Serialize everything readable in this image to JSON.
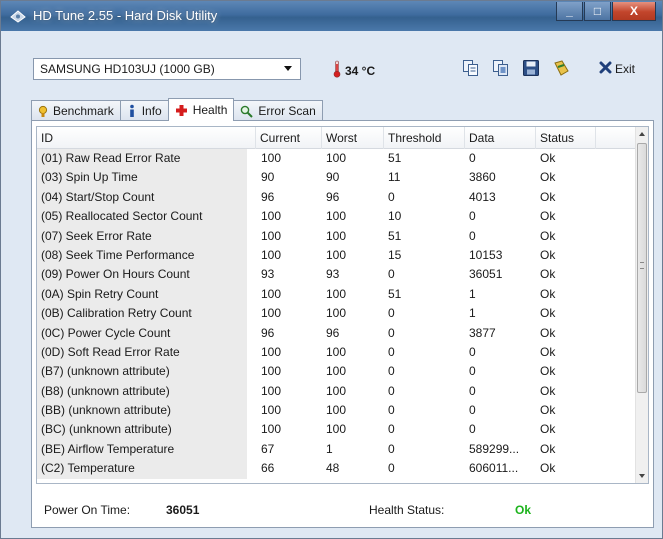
{
  "window": {
    "title": "HD Tune 2.55 - Hard Disk Utility",
    "buttons": {
      "minimize": "_",
      "maximize": "□",
      "close": "X"
    }
  },
  "toolbar": {
    "drive": "SAMSUNG HD103UJ (1000 GB)",
    "temperature": "34 °C",
    "icons": [
      "copy-text-icon",
      "copy-screenshot-icon",
      "save-icon",
      "options-icon"
    ],
    "exit_label": "Exit"
  },
  "tabs": [
    {
      "label": "Benchmark",
      "icon": "benchmark-icon"
    },
    {
      "label": "Info",
      "icon": "info-icon"
    },
    {
      "label": "Health",
      "icon": "health-icon",
      "active": true
    },
    {
      "label": "Error Scan",
      "icon": "error-scan-icon"
    }
  ],
  "health_table": {
    "columns": [
      "ID",
      "Current",
      "Worst",
      "Threshold",
      "Data",
      "Status"
    ],
    "rows": [
      [
        "(01) Raw Read Error Rate",
        "100",
        "100",
        "51",
        "0",
        "Ok"
      ],
      [
        "(03) Spin Up Time",
        "90",
        "90",
        "11",
        "3860",
        "Ok"
      ],
      [
        "(04) Start/Stop Count",
        "96",
        "96",
        "0",
        "4013",
        "Ok"
      ],
      [
        "(05) Reallocated Sector Count",
        "100",
        "100",
        "10",
        "0",
        "Ok"
      ],
      [
        "(07) Seek Error Rate",
        "100",
        "100",
        "51",
        "0",
        "Ok"
      ],
      [
        "(08) Seek Time Performance",
        "100",
        "100",
        "15",
        "10153",
        "Ok"
      ],
      [
        "(09) Power On Hours Count",
        "93",
        "93",
        "0",
        "36051",
        "Ok"
      ],
      [
        "(0A) Spin Retry Count",
        "100",
        "100",
        "51",
        "1",
        "Ok"
      ],
      [
        "(0B) Calibration Retry Count",
        "100",
        "100",
        "0",
        "1",
        "Ok"
      ],
      [
        "(0C) Power Cycle Count",
        "96",
        "96",
        "0",
        "3877",
        "Ok"
      ],
      [
        "(0D) Soft Read Error Rate",
        "100",
        "100",
        "0",
        "0",
        "Ok"
      ],
      [
        "(B7) (unknown attribute)",
        "100",
        "100",
        "0",
        "0",
        "Ok"
      ],
      [
        "(B8) (unknown attribute)",
        "100",
        "100",
        "0",
        "0",
        "Ok"
      ],
      [
        "(BB) (unknown attribute)",
        "100",
        "100",
        "0",
        "0",
        "Ok"
      ],
      [
        "(BC) (unknown attribute)",
        "100",
        "100",
        "0",
        "0",
        "Ok"
      ],
      [
        "(BE) Airflow Temperature",
        "67",
        "1",
        "0",
        "589299...",
        "Ok"
      ],
      [
        "(C2) Temperature",
        "66",
        "48",
        "0",
        "606011...",
        "Ok"
      ]
    ]
  },
  "status": {
    "power_on_label": "Power On Time:",
    "power_on_value": "36051",
    "health_label": "Health Status:",
    "health_value": "Ok",
    "health_color": "#1bb31b"
  }
}
